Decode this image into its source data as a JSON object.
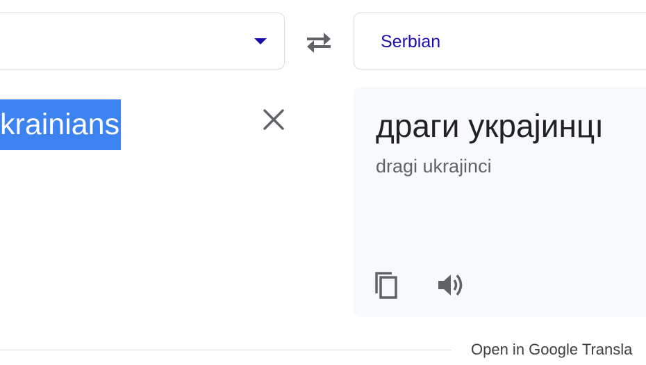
{
  "source": {
    "language_select": {
      "icon": "chevron-down-icon"
    },
    "text": "krainians",
    "clear_icon": "close-icon"
  },
  "swap_icon": "swap-languages-icon",
  "target": {
    "language_label": "Serbian",
    "translation": "драги украјинцı",
    "transliteration": "dragi ukrajinci",
    "copy_icon": "copy-icon",
    "listen_icon": "speaker-icon"
  },
  "footer": {
    "open_link": "Open in Google Transla"
  },
  "colors": {
    "accent": "#1a0dab",
    "selection": "#3c82f0",
    "panel": "#f8f9fa"
  }
}
